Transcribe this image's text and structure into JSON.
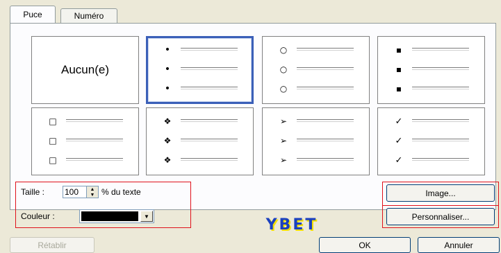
{
  "tabs": [
    {
      "label": "Puce",
      "active": true
    },
    {
      "label": "Numéro",
      "active": false
    }
  ],
  "bullets": {
    "none_label": "Aucun(e)",
    "cells": [
      {
        "type": "none"
      },
      {
        "type": "bullet",
        "glyph": "•",
        "selected": true
      },
      {
        "type": "bullet",
        "glyph": "○",
        "selected": false
      },
      {
        "type": "bullet",
        "glyph": "▪",
        "selected": false
      },
      {
        "type": "bullet",
        "glyph": "□",
        "selected": false
      },
      {
        "type": "bullet",
        "glyph": "❖",
        "selected": false
      },
      {
        "type": "bullet",
        "glyph": "➢",
        "selected": false
      },
      {
        "type": "bullet",
        "glyph": "✓",
        "selected": false
      }
    ]
  },
  "size": {
    "label": "Taille :",
    "value": "100",
    "suffix": "% du texte"
  },
  "color": {
    "label": "Couleur :",
    "value": "#000000"
  },
  "logo_text": "YBET",
  "buttons": {
    "image": "Image...",
    "customize": "Personnaliser...",
    "reset": "Rétablir",
    "ok": "OK",
    "cancel": "Annuler"
  },
  "colors": {
    "selection": "#3a5fb8",
    "highlight_box": "#e0101a",
    "logo_fill": "#1a40c0",
    "logo_shadow": "#f4e000"
  }
}
